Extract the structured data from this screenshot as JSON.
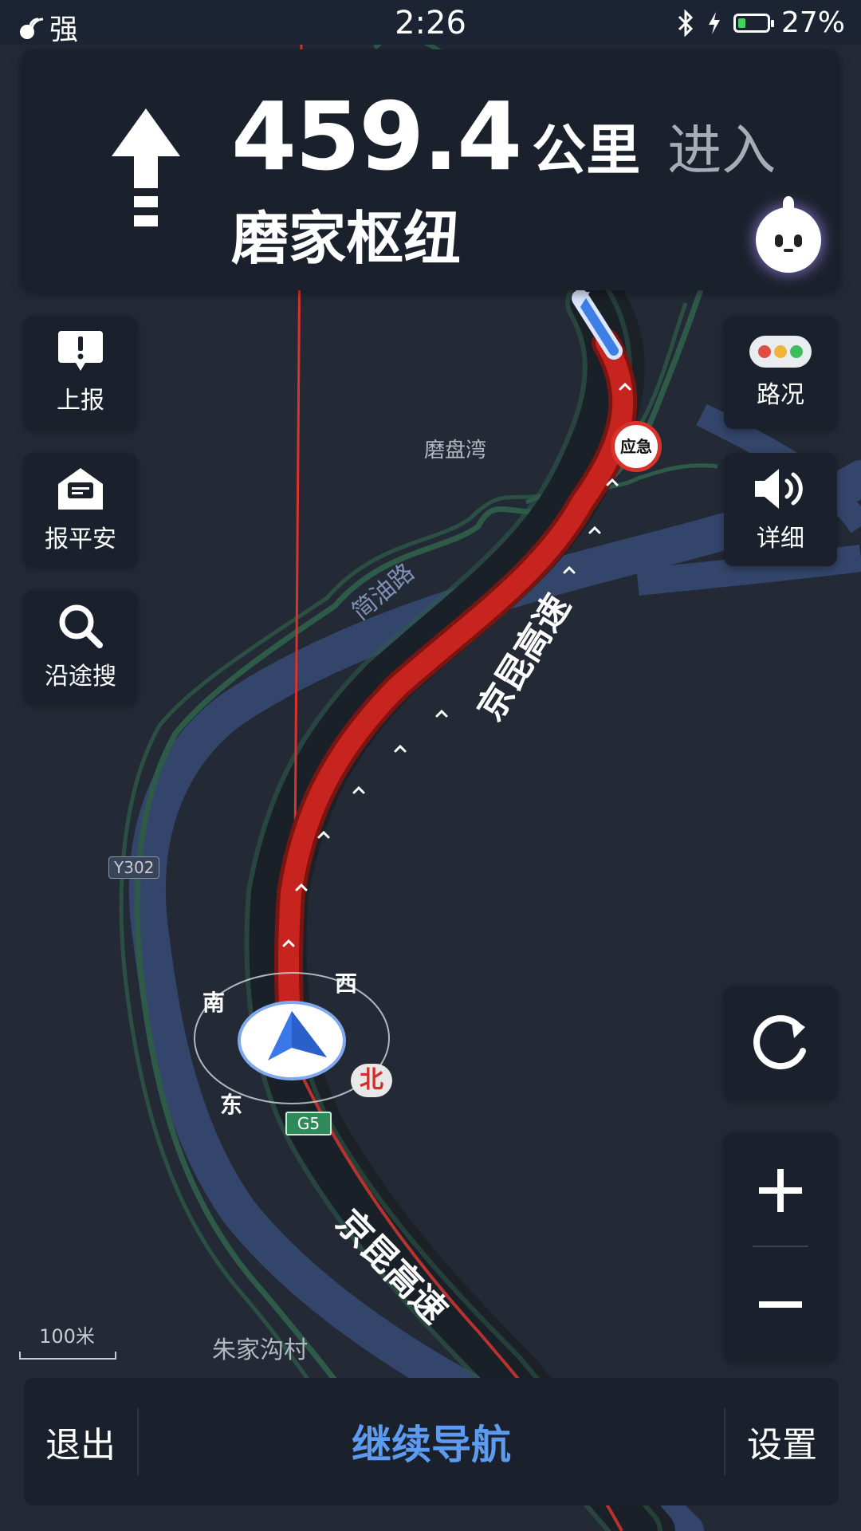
{
  "status_bar": {
    "signal_text": "强",
    "time": "2:26",
    "battery_percent": "27%",
    "battery_level": 0.27
  },
  "guidance": {
    "distance_value": "459.4",
    "distance_unit": "公里",
    "action": "进入",
    "road_name": "磨家枢纽",
    "direction": "straight"
  },
  "left_buttons": {
    "report": "上报",
    "safe": "报平安",
    "search": "沿途搜"
  },
  "right_buttons": {
    "traffic": "路况",
    "detail": "详细"
  },
  "map": {
    "place_mopanwan": "磨盘湾",
    "place_zhujiagou": "朱家沟村",
    "road_jianyou": "简油路",
    "road_jingkun_top": "京昆高速",
    "road_jingkun_bottom": "京昆高速",
    "badge_y302": "Y302",
    "badge_g5": "G5",
    "emergency_sign": "应急",
    "compass": {
      "south": "南",
      "west": "西",
      "east": "东",
      "north": "北"
    },
    "scale_label": "100米"
  },
  "bottom_bar": {
    "exit": "退出",
    "continue": "继续导航",
    "settings": "设置"
  },
  "colors": {
    "route": "#c8241f",
    "river": "#364a6e",
    "accent_blue": "#5d9bf0",
    "panel": "#1b212c"
  }
}
